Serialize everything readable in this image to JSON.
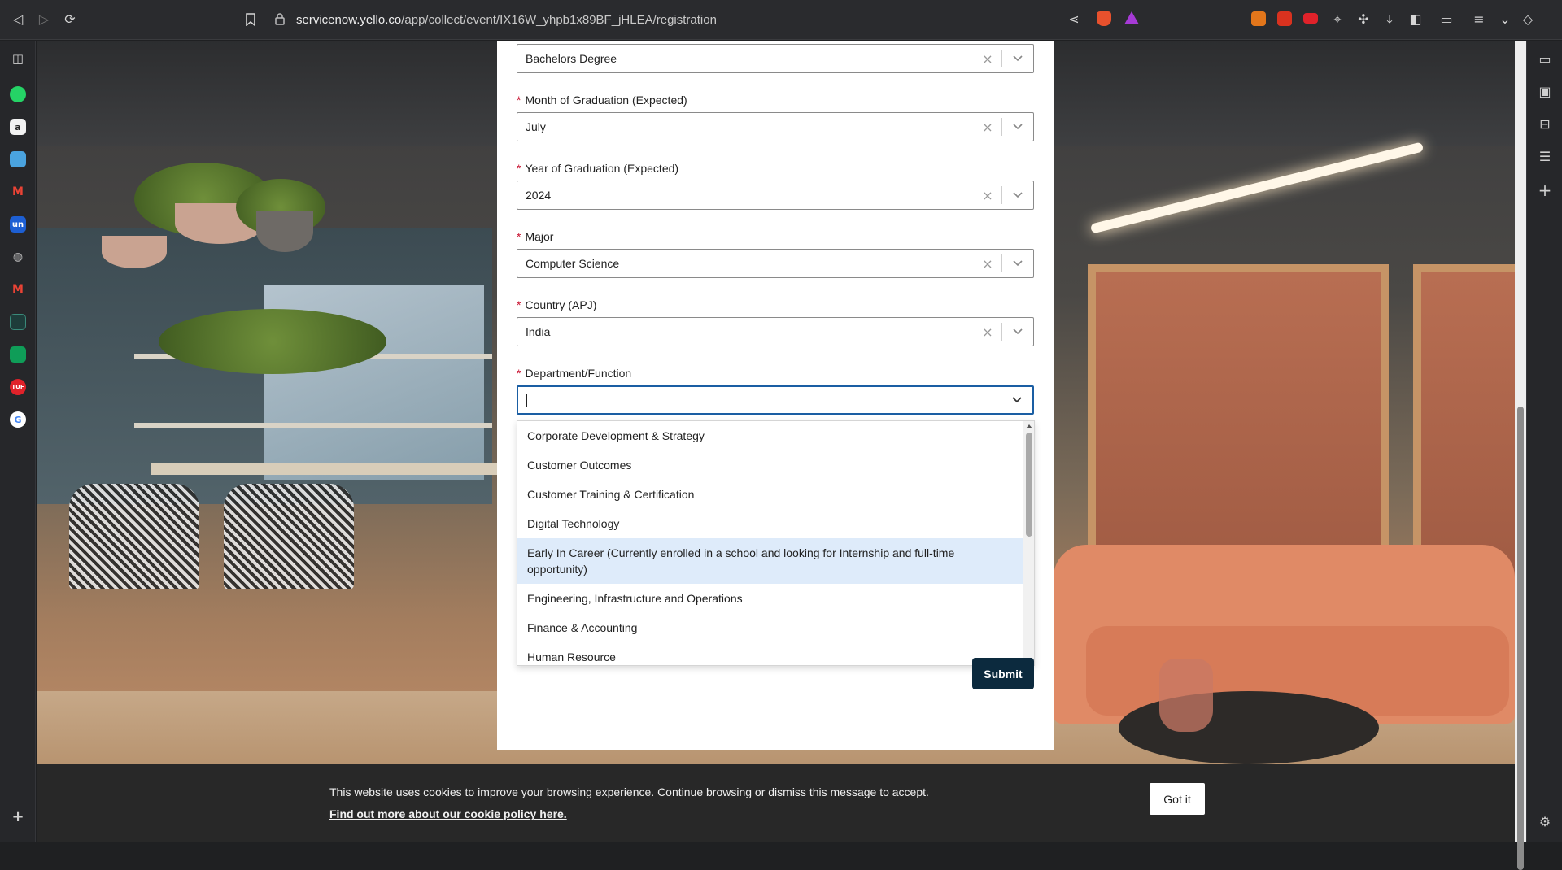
{
  "browser": {
    "url_host": "servicenow.yello.co",
    "url_path": "/app/collect/event/IX16W_yhpb1x89BF_jHLEA/registration"
  },
  "sidebar": {
    "items": [
      "whatsapp",
      "amazon",
      "chat",
      "gmail",
      "un",
      "web",
      "gmail2",
      "app",
      "sheets",
      "tui",
      "google"
    ]
  },
  "form": {
    "degree": {
      "value": "Bachelors Degree"
    },
    "graduation_month": {
      "label": "Month of Graduation (Expected)",
      "value": "July"
    },
    "graduation_year": {
      "label": "Year of Graduation (Expected)",
      "value": "2024"
    },
    "major": {
      "label": "Major",
      "value": "Computer Science"
    },
    "country": {
      "label": "Country (APJ)",
      "value": "India"
    },
    "department": {
      "label": "Department/Function",
      "value": ""
    },
    "required_mark": "*",
    "submit_label": "Submit"
  },
  "dropdown": {
    "options": [
      "Corporate Development & Strategy",
      "Customer Outcomes",
      "Customer Training & Certification",
      "Digital Technology",
      "Early In Career (Currently enrolled in a school and looking for Internship and full-time opportunity)",
      "Engineering, Infrastructure and Operations",
      "Finance & Accounting",
      "Human Resource"
    ],
    "highlighted_index": 4
  },
  "cookie_banner": {
    "message": "This website uses cookies to improve your browsing experience. Continue browsing or dismiss this message to accept.",
    "link": "Find out more about our cookie policy here.",
    "button": "Got it"
  },
  "icons": {
    "clear": "×"
  }
}
